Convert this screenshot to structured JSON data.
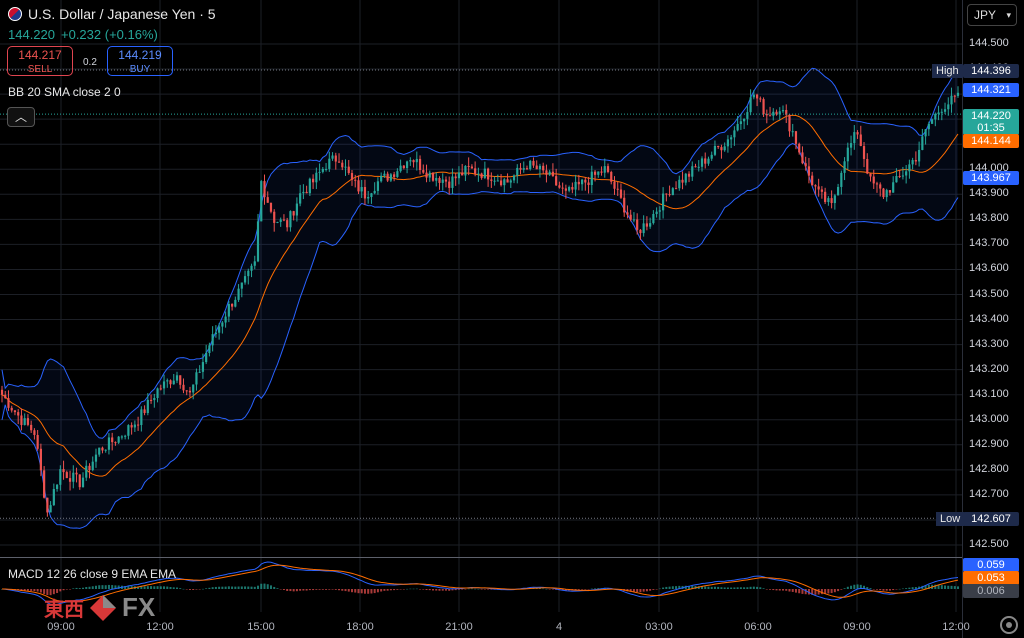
{
  "header": {
    "title": "U.S. Dollar / Japanese Yen · 5",
    "price": "144.220",
    "change": "+0.232 (+0.16%)",
    "sell_price": "144.217",
    "sell_label": "SELL",
    "spread": "0.2",
    "buy_price": "144.219",
    "buy_label": "BUY"
  },
  "indicators": {
    "bb_label": "BB 20 SMA close 2 0",
    "macd_label": "MACD 12 26 close 9 EMA EMA",
    "collapse_icon": "chevron-up-icon"
  },
  "currency": {
    "label": "JPY"
  },
  "price_axis": {
    "ticks": [
      "144.500",
      "144.400",
      "144.300",
      "144.200",
      "144.100",
      "144.000",
      "143.900",
      "143.800",
      "143.700",
      "143.600",
      "143.500",
      "143.400",
      "143.300",
      "143.200",
      "143.100",
      "143.000",
      "142.900",
      "142.800",
      "142.700",
      "142.600",
      "142.500"
    ]
  },
  "price_tags": {
    "high_label": "High",
    "high_value": "144.396",
    "bb_upper": "144.321",
    "last_price": "144.220",
    "countdown": "01:35",
    "bb_basis": "144.144",
    "bb_lower": "143.967",
    "low_label": "Low",
    "low_value": "142.607"
  },
  "macd_tags": {
    "macd": "0.059",
    "signal": "0.053",
    "histogram": "0.006"
  },
  "time_axis": [
    "09:00",
    "12:00",
    "15:00",
    "18:00",
    "21:00",
    "4",
    "03:00",
    "06:00",
    "09:00",
    "12:00"
  ],
  "colors": {
    "up": "#26a69a",
    "down": "#ef5350",
    "bb_band": "#2962ff",
    "basis": "#ff6d00",
    "macd_line": "#2962ff",
    "signal_line": "#ff6d00"
  },
  "logo": {
    "text": "東西",
    "fx": "FX"
  },
  "chart_data": {
    "type": "candlestick",
    "symbol": "USDJPY",
    "interval": "5",
    "ylim": [
      142.5,
      144.5
    ],
    "high": 144.396,
    "low": 142.607,
    "last": 144.22,
    "anchors": [
      [
        0,
        143.1
      ],
      [
        6,
        143.0
      ],
      [
        10,
        142.95
      ],
      [
        14,
        142.63
      ],
      [
        18,
        142.8
      ],
      [
        24,
        142.75
      ],
      [
        30,
        142.88
      ],
      [
        36,
        142.93
      ],
      [
        42,
        143.0
      ],
      [
        48,
        143.12
      ],
      [
        54,
        143.18
      ],
      [
        58,
        143.1
      ],
      [
        64,
        143.3
      ],
      [
        70,
        143.45
      ],
      [
        75,
        143.55
      ],
      [
        78,
        143.62
      ],
      [
        80,
        143.95
      ],
      [
        84,
        143.8
      ],
      [
        88,
        143.78
      ],
      [
        92,
        143.9
      ],
      [
        96,
        143.95
      ],
      [
        100,
        144.02
      ],
      [
        104,
        144.05
      ],
      [
        108,
        143.95
      ],
      [
        112,
        143.9
      ],
      [
        116,
        143.95
      ],
      [
        120,
        143.98
      ],
      [
        126,
        144.05
      ],
      [
        132,
        143.98
      ],
      [
        138,
        143.95
      ],
      [
        144,
        144.0
      ],
      [
        150,
        143.98
      ],
      [
        156,
        143.95
      ],
      [
        162,
        144.02
      ],
      [
        168,
        143.98
      ],
      [
        174,
        143.9
      ],
      [
        180,
        143.95
      ],
      [
        186,
        144.0
      ],
      [
        192,
        143.85
      ],
      [
        196,
        143.75
      ],
      [
        200,
        143.8
      ],
      [
        206,
        143.92
      ],
      [
        212,
        143.98
      ],
      [
        218,
        144.05
      ],
      [
        224,
        144.12
      ],
      [
        228,
        144.2
      ],
      [
        232,
        144.3
      ],
      [
        236,
        144.22
      ],
      [
        240,
        144.25
      ],
      [
        244,
        144.15
      ],
      [
        248,
        144.0
      ],
      [
        252,
        143.9
      ],
      [
        256,
        143.85
      ],
      [
        260,
        144.05
      ],
      [
        264,
        144.15
      ],
      [
        268,
        143.95
      ],
      [
        272,
        143.9
      ],
      [
        276,
        143.95
      ],
      [
        282,
        144.05
      ],
      [
        286,
        144.18
      ],
      [
        290,
        144.25
      ],
      [
        294,
        144.28
      ]
    ],
    "macd": {
      "macd": 0.059,
      "signal": 0.053,
      "histogram": 0.006
    }
  }
}
